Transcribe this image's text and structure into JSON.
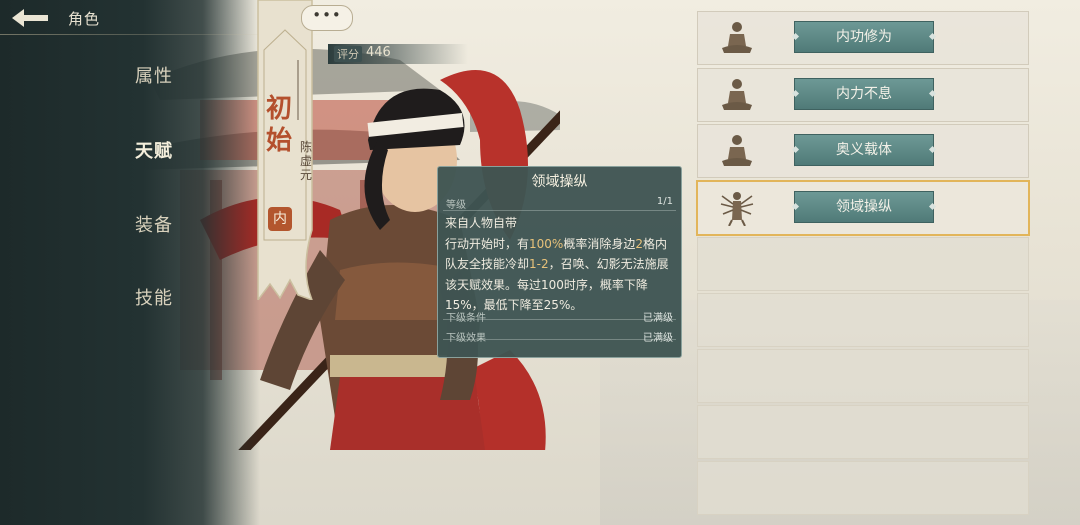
{
  "header": {
    "title": "角色",
    "more_label": "•••"
  },
  "nav": {
    "items": [
      "属性",
      "天赋",
      "装备",
      "技能"
    ],
    "active": "天赋"
  },
  "character": {
    "rank_top": "初",
    "rank_bottom": "始",
    "name": "陈虚元",
    "type_badge": "内",
    "score_label": "评分",
    "score_value": "446"
  },
  "tooltip": {
    "title": "领域操纵",
    "level_label": "等级",
    "level_value": "1/1",
    "line1": "来自人物自带",
    "desc_a": "行动开始时，有",
    "desc_b": "100%",
    "desc_c": "概率消除身边",
    "desc_d": "2",
    "desc_e": "格内队友全技能冷却",
    "desc_f": "1-2",
    "desc_g": "，召唤、幻影无法施展该天赋效果。每过100时序，概率下降15%，最低下降至25%。",
    "next_cond_label": "下级条件",
    "next_cond_value": "已满级",
    "next_effect_label": "下级效果",
    "next_effect_value": "已满级"
  },
  "skills": [
    {
      "label": "内功修为",
      "icon": "meditating-figure-icon"
    },
    {
      "label": "内力不息",
      "icon": "meditating-figure-icon"
    },
    {
      "label": "奥义载体",
      "icon": "meditating-figure-icon"
    },
    {
      "label": "领域操纵",
      "icon": "multi-armed-figure-icon",
      "selected": true
    }
  ],
  "colors": {
    "accent": "#e2b55a",
    "skill_button": "#5f8b88",
    "highlight": "#e8c27a",
    "badge": "#b3562e"
  }
}
